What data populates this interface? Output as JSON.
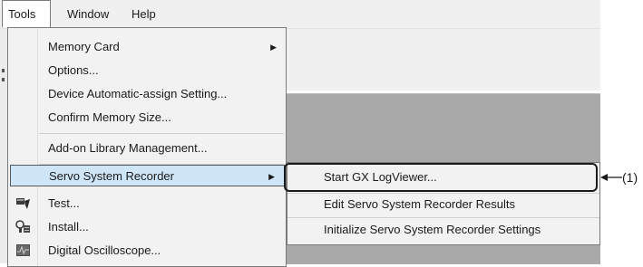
{
  "menubar": {
    "items": [
      {
        "label": "Tools"
      },
      {
        "label": "Window"
      },
      {
        "label": "Help"
      }
    ]
  },
  "tools_menu": {
    "items": [
      {
        "label": "Memory Card",
        "has_submenu": true
      },
      {
        "label": "Options..."
      },
      {
        "label": "Device Automatic-assign Setting..."
      },
      {
        "label": "Confirm Memory Size..."
      },
      {
        "label": "Add-on Library Management..."
      },
      {
        "label": "Servo System Recorder",
        "has_submenu": true,
        "highlighted": true
      },
      {
        "label": "Test...",
        "icon": "test-icon"
      },
      {
        "label": "Install...",
        "icon": "install-icon"
      },
      {
        "label": "Digital Oscilloscope...",
        "icon": "oscilloscope-icon"
      }
    ]
  },
  "servo_submenu": {
    "items": [
      {
        "label": "Start GX LogViewer...",
        "highlighted": true
      },
      {
        "label": "Edit Servo System Recorder Results"
      },
      {
        "label": "Initialize Servo System Recorder Settings"
      }
    ]
  },
  "callout": {
    "label": "(1)"
  },
  "colors": {
    "highlight": "#cfe6f8",
    "menu_bg": "#f2f2f2",
    "workspace": "#a9a9a9"
  },
  "icons": {
    "submenu_arrow": "▶"
  }
}
